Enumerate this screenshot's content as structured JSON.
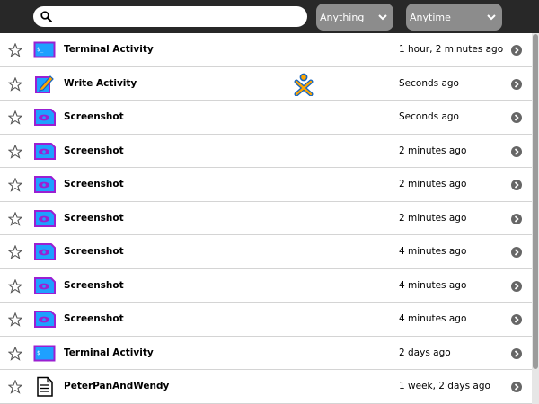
{
  "search": {
    "value": "",
    "placeholder": ""
  },
  "filters": {
    "type_selected": "Anything",
    "time_selected": "Anytime"
  },
  "entries": [
    {
      "title": "Terminal Activity",
      "time": "1 hour, 2 minutes ago",
      "icon": "terminal-icon"
    },
    {
      "title": "Write Activity",
      "time": "Seconds ago",
      "icon": "write-icon"
    },
    {
      "title": "Screenshot",
      "time": "Seconds ago",
      "icon": "screenshot-icon"
    },
    {
      "title": "Screenshot",
      "time": "2 minutes ago",
      "icon": "screenshot-icon"
    },
    {
      "title": "Screenshot",
      "time": "2 minutes ago",
      "icon": "screenshot-icon"
    },
    {
      "title": "Screenshot",
      "time": "2 minutes ago",
      "icon": "screenshot-icon"
    },
    {
      "title": "Screenshot",
      "time": "4 minutes ago",
      "icon": "screenshot-icon"
    },
    {
      "title": "Screenshot",
      "time": "4 minutes ago",
      "icon": "screenshot-icon"
    },
    {
      "title": "Screenshot",
      "time": "4 minutes ago",
      "icon": "screenshot-icon"
    },
    {
      "title": "Terminal Activity",
      "time": "2 days ago",
      "icon": "terminal-icon"
    },
    {
      "title": "PeterPanAndWendy",
      "time": "1 week, 2 days ago",
      "icon": "document-icon"
    }
  ],
  "colors": {
    "toolbar_bg": "#282828",
    "dropdown_bg": "#8c8c8c",
    "icon_fill": "#1ea0ff",
    "icon_stroke": "#9b1fd2",
    "buddy_fill": "#ffa500",
    "buddy_stroke": "#1565c0"
  }
}
